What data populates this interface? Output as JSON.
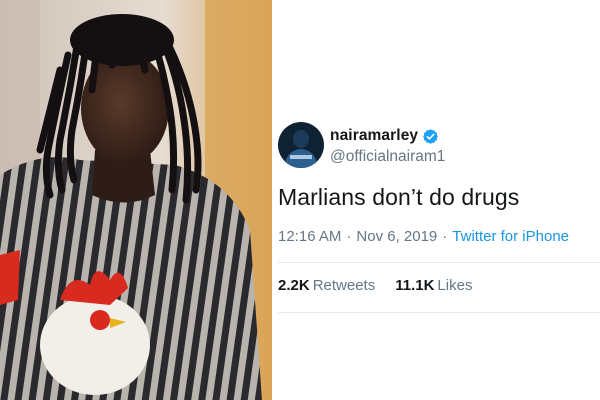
{
  "photo": {
    "subject": "man with dreadlocks wearing striped shirt with rooster print"
  },
  "tweet": {
    "display_name": "nairamarley",
    "handle": "@officialnairam1",
    "text": "Marlians don’t do drugs",
    "time": "12:16 AM",
    "separator": "·",
    "date": "Nov 6, 2019",
    "source": "Twitter for iPhone",
    "retweets_count": "2.2K",
    "retweets_label": "Retweets",
    "likes_count": "11.1K",
    "likes_label": "Likes"
  },
  "colors": {
    "text": "#14171a",
    "secondary": "#657786",
    "link": "#1b95e0",
    "verified": "#1da1f2",
    "divider": "#e6ecf0"
  },
  "icons": {
    "verified": "verified-badge-icon"
  }
}
